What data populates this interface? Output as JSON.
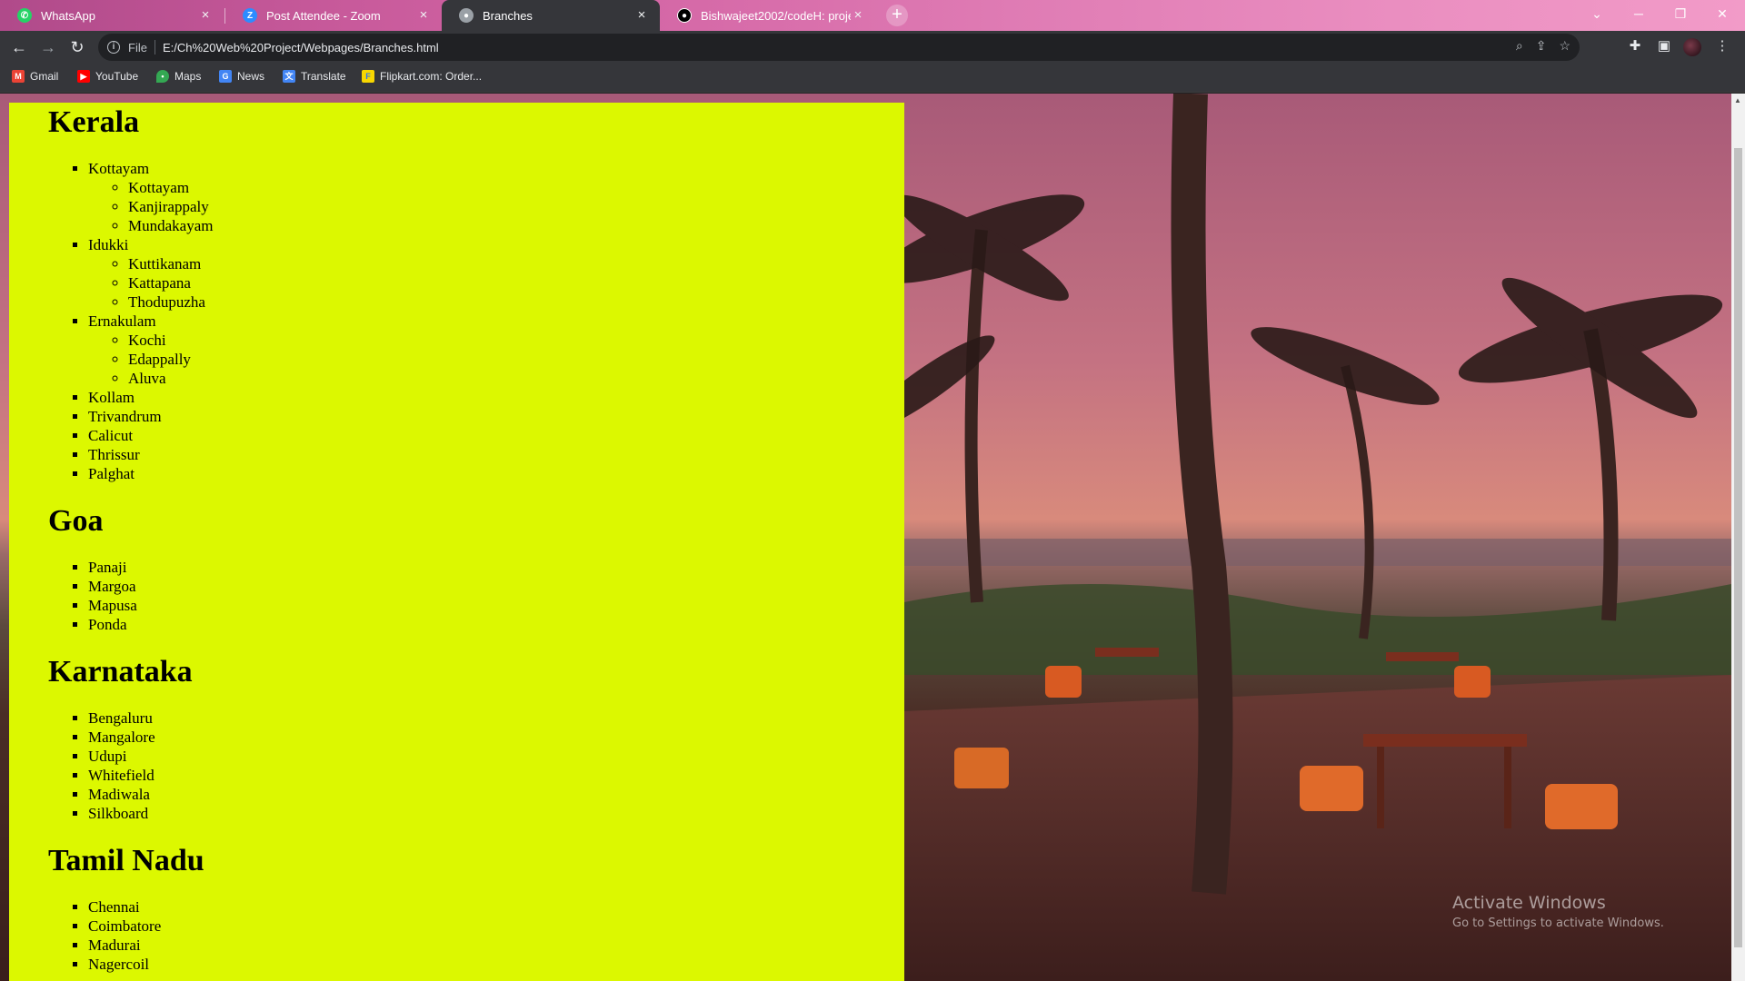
{
  "browser": {
    "tabs": [
      {
        "title": "WhatsApp",
        "icon": "whatsapp-icon",
        "color": "#25d366",
        "active": false
      },
      {
        "title": "Post Attendee - Zoom",
        "icon": "zoom-icon",
        "color": "#2d8cff",
        "active": false
      },
      {
        "title": "Branches",
        "icon": "globe-icon",
        "color": "#9aa0a6",
        "active": true
      },
      {
        "title": "Bishwajeet2002/codeH: project",
        "icon": "github-icon",
        "color": "#000000",
        "active": false
      }
    ],
    "new_tab_label": "+",
    "nav": {
      "back": "←",
      "forward": "→",
      "reload": "↻"
    },
    "address": {
      "scheme": "File",
      "url": "E:/Ch%20Web%20Project/Webpages/Branches.html"
    },
    "bookmarks": [
      {
        "label": "Gmail",
        "icon": "gmail-icon",
        "color": "#ea4335"
      },
      {
        "label": "YouTube",
        "icon": "youtube-icon",
        "color": "#ff0000"
      },
      {
        "label": "Maps",
        "icon": "maps-icon",
        "color": "#34a853"
      },
      {
        "label": "News",
        "icon": "news-icon",
        "color": "#4285f4"
      },
      {
        "label": "Translate",
        "icon": "translate-icon",
        "color": "#4285f4"
      },
      {
        "label": "Flipkart.com: Order...",
        "icon": "flipkart-icon",
        "color": "#f7d600"
      }
    ]
  },
  "page": {
    "background_color": "#dcf800",
    "sections": [
      {
        "heading": "Kerala",
        "items": [
          {
            "label": "Kottayam",
            "children": [
              "Kottayam",
              "Kanjirappaly",
              "Mundakayam"
            ]
          },
          {
            "label": "Idukki",
            "children": [
              "Kuttikanam",
              "Kattapana",
              "Thodupuzha"
            ]
          },
          {
            "label": "Ernakulam",
            "children": [
              "Kochi",
              "Edappally",
              "Aluva"
            ]
          },
          {
            "label": "Kollam",
            "children": []
          },
          {
            "label": "Trivandrum",
            "children": []
          },
          {
            "label": "Calicut",
            "children": []
          },
          {
            "label": "Thrissur",
            "children": []
          },
          {
            "label": "Palghat",
            "children": []
          }
        ]
      },
      {
        "heading": "Goa",
        "items": [
          {
            "label": "Panaji",
            "children": []
          },
          {
            "label": "Margoa",
            "children": []
          },
          {
            "label": "Mapusa",
            "children": []
          },
          {
            "label": "Ponda",
            "children": []
          }
        ]
      },
      {
        "heading": "Karnataka",
        "items": [
          {
            "label": "Bengaluru",
            "children": []
          },
          {
            "label": "Mangalore",
            "children": []
          },
          {
            "label": "Udupi",
            "children": []
          },
          {
            "label": "Whitefield",
            "children": []
          },
          {
            "label": "Madiwala",
            "children": []
          },
          {
            "label": "Silkboard",
            "children": []
          }
        ]
      },
      {
        "heading": "Tamil Nadu",
        "items": [
          {
            "label": "Chennai",
            "children": []
          },
          {
            "label": "Coimbatore",
            "children": []
          },
          {
            "label": "Madurai",
            "children": []
          },
          {
            "label": "Nagercoil",
            "children": []
          }
        ]
      }
    ]
  },
  "watermark": {
    "line1": "Activate Windows",
    "line2": "Go to Settings to activate Windows."
  }
}
